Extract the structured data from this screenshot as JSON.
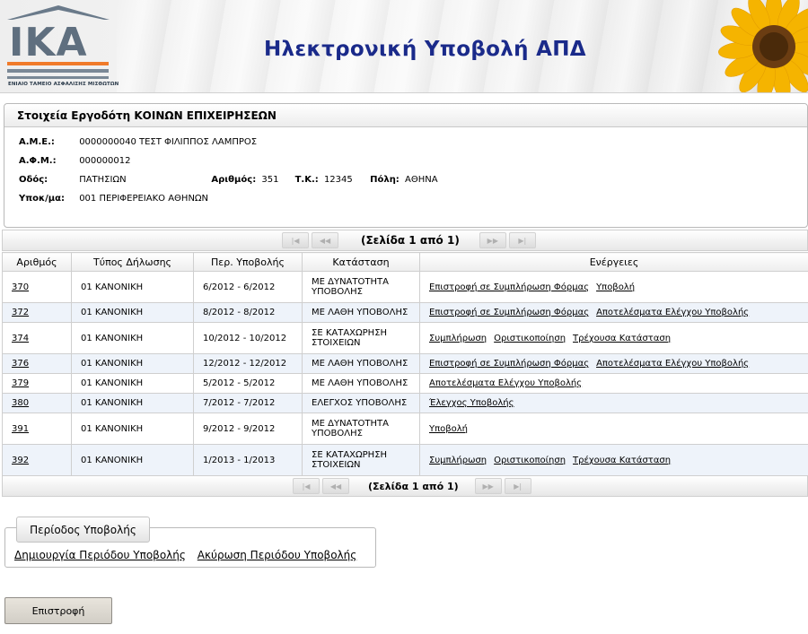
{
  "header": {
    "logo_text": "IKA",
    "logo_subtitle": "ΕΝΙΑΙΟ ΤΑΜΕΙΟ ΑΣΦΑΛΙΣΗΣ ΜΙΣΘΩΤΩΝ",
    "title": "Ηλεκτρονική Υποβολή ΑΠΔ"
  },
  "employer": {
    "section_title": "Στοιχεία Εργοδότη ΚΟΙΝΩΝ ΕΠΙΧΕΙΡΗΣΕΩΝ",
    "ame_label": "Α.Μ.Ε.:",
    "ame_value": "0000000040 ΤΕΣΤ ΦΙΛΙΠΠΟΣ ΛΑΜΠΡΟΣ",
    "afm_label": "Α.Φ.Μ.:",
    "afm_value": "000000012",
    "street_label": "Οδός:",
    "street_value": "ΠΑΤΗΣΙΩΝ",
    "number_label": "Αριθμός:",
    "number_value": "351",
    "tk_label": "Τ.Κ.:",
    "tk_value": "12345",
    "city_label": "Πόλη:",
    "city_value": "ΑΘΗΝΑ",
    "branch_label": "Υποκ/μα:",
    "branch_value": "001 ΠΕΡΙΦΕΡΕΙΑΚΟ ΑΘΗΝΩΝ"
  },
  "pager": {
    "top_text": "(Σελίδα 1 από 1)",
    "bottom_text": "(Σελίδα 1 από 1)",
    "first_icon": "first-page-icon",
    "prev_icon": "prev-page-icon",
    "next_icon": "next-page-icon",
    "last_icon": "last-page-icon"
  },
  "table": {
    "headers": [
      "Αριθμός",
      "Τύπος Δήλωσης",
      "Περ. Υποβολής",
      "Κατάσταση",
      "Ενέργειες"
    ],
    "rows": [
      {
        "id": "370",
        "type": "01 ΚΑΝΟΝΙΚΗ",
        "period": "6/2012 - 6/2012",
        "status": "ΜΕ ΔΥΝΑΤΟΤΗΤΑ ΥΠΟΒΟΛΗΣ",
        "actions": [
          "Επιστροφή σε Συμπλήρωση Φόρμας",
          "Υποβολή"
        ]
      },
      {
        "id": "372",
        "type": "01 ΚΑΝΟΝΙΚΗ",
        "period": "8/2012 - 8/2012",
        "status": "ΜΕ ΛΑΘΗ ΥΠΟΒΟΛΗΣ",
        "actions": [
          "Επιστροφή σε Συμπλήρωση Φόρμας",
          "Αποτελέσματα Ελέγχου Υποβολής"
        ]
      },
      {
        "id": "374",
        "type": "01 ΚΑΝΟΝΙΚΗ",
        "period": "10/2012 - 10/2012",
        "status": "ΣΕ ΚΑΤΑΧΩΡΗΣΗ ΣΤΟΙΧΕΙΩΝ",
        "actions": [
          "Συμπλήρωση",
          "Οριστικοποίηση",
          "Τρέχουσα Κατάσταση"
        ]
      },
      {
        "id": "376",
        "type": "01 ΚΑΝΟΝΙΚΗ",
        "period": "12/2012 - 12/2012",
        "status": "ΜΕ ΛΑΘΗ ΥΠΟΒΟΛΗΣ",
        "actions": [
          "Επιστροφή σε Συμπλήρωση Φόρμας",
          "Αποτελέσματα Ελέγχου Υποβολής"
        ]
      },
      {
        "id": "379",
        "type": "01 ΚΑΝΟΝΙΚΗ",
        "period": "5/2012 - 5/2012",
        "status": "ΜΕ ΛΑΘΗ ΥΠΟΒΟΛΗΣ",
        "actions": [
          "Αποτελέσματα Ελέγχου Υποβολής"
        ]
      },
      {
        "id": "380",
        "type": "01 ΚΑΝΟΝΙΚΗ",
        "period": "7/2012 - 7/2012",
        "status": "ΕΛΕΓΧΟΣ ΥΠΟΒΟΛΗΣ",
        "actions": [
          "Έλεγχος Υποβολής"
        ]
      },
      {
        "id": "391",
        "type": "01 ΚΑΝΟΝΙΚΗ",
        "period": "9/2012 - 9/2012",
        "status": "ΜΕ ΔΥΝΑΤΟΤΗΤΑ ΥΠΟΒΟΛΗΣ",
        "actions": [
          "Υποβολή"
        ]
      },
      {
        "id": "392",
        "type": "01 ΚΑΝΟΝΙΚΗ",
        "period": "1/2013 - 1/2013",
        "status": "ΣΕ ΚΑΤΑΧΩΡΗΣΗ ΣΤΟΙΧΕΙΩΝ",
        "actions": [
          "Συμπλήρωση",
          "Οριστικοποίηση",
          "Τρέχουσα Κατάσταση"
        ]
      }
    ]
  },
  "period": {
    "legend": "Περίοδος Υποβολής",
    "create_link": "Δημιουργία Περιόδου Υποβολής",
    "cancel_link": "Ακύρωση Περιόδου Υποβολής"
  },
  "back_button": "Επιστροφή",
  "colors": {
    "title_blue": "#1a2a8a",
    "logo_orange": "#f07a2a",
    "logo_grey": "#5f6f7f",
    "alt_row": "#eef3fa"
  }
}
